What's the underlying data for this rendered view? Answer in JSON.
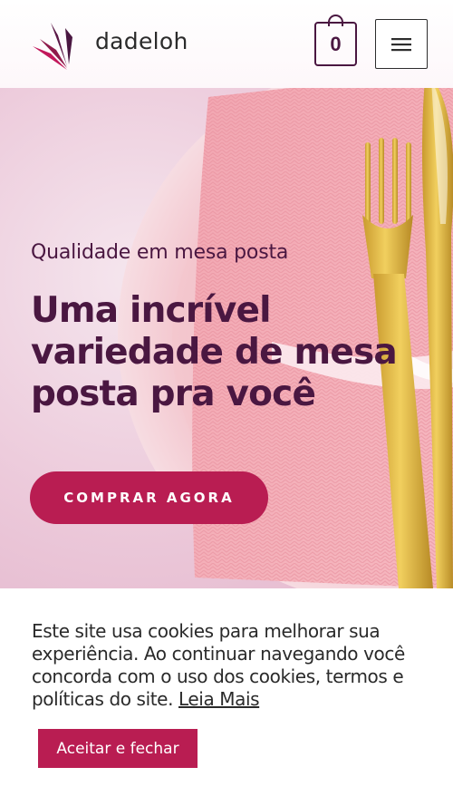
{
  "header": {
    "brand": "dadeloh",
    "cart_count": "0",
    "logo_icon": "chevron-fan-logo-icon",
    "cart_icon": "shopping-bag-icon",
    "menu_icon": "hamburger-menu-icon"
  },
  "hero": {
    "subtitle": "Qualidade em mesa posta",
    "title": "Uma incrível variedade de mesa posta pra você",
    "cta_label": "COMPRAR AGORA",
    "image_subject": "pink-plate-napkin-gold-cutlery-image"
  },
  "cookie_banner": {
    "text": "Este site usa cookies para melhorar sua experiência. Ao continuar navegando você concorda com o uso dos cookies, termos e políticas do site.",
    "link_label": "Leia Mais",
    "accept_label": "Aceitar e fechar"
  },
  "colors": {
    "brand_plum": "#4a1741",
    "accent_crimson": "#b91d52",
    "hero_pink": "#ecc9da"
  }
}
